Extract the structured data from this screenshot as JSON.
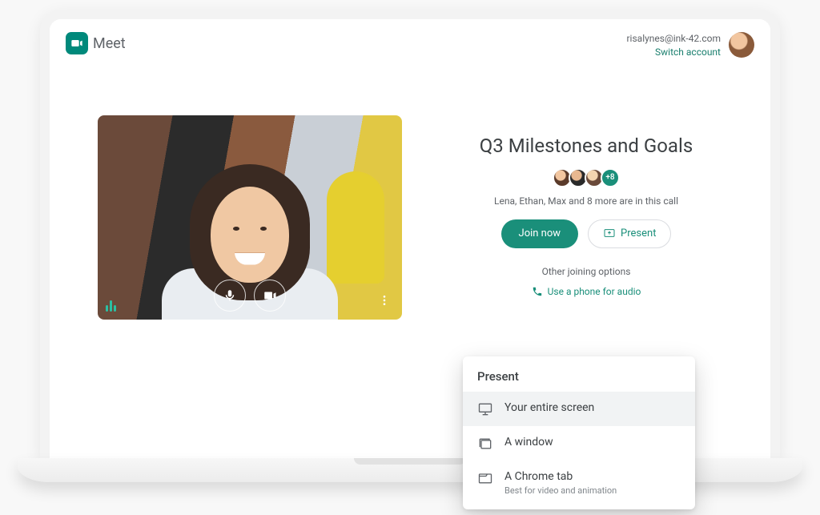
{
  "brand": {
    "name": "Meet"
  },
  "account": {
    "email": "risalynes@ink-42.com",
    "switch_label": "Switch account"
  },
  "meeting": {
    "title": "Q3 Milestones and Goals",
    "participants_text": "Lena, Ethan, Max and 8 more are in this call",
    "overflow_badge": "+8",
    "join_label": "Join now",
    "present_label": "Present",
    "other_options_label": "Other joining options",
    "phone_label": "Use a phone for audio"
  },
  "present_menu": {
    "title": "Present",
    "items": [
      {
        "label": "Your entire screen",
        "sub": ""
      },
      {
        "label": "A window",
        "sub": ""
      },
      {
        "label": "A Chrome tab",
        "sub": "Best for video and animation"
      }
    ]
  }
}
